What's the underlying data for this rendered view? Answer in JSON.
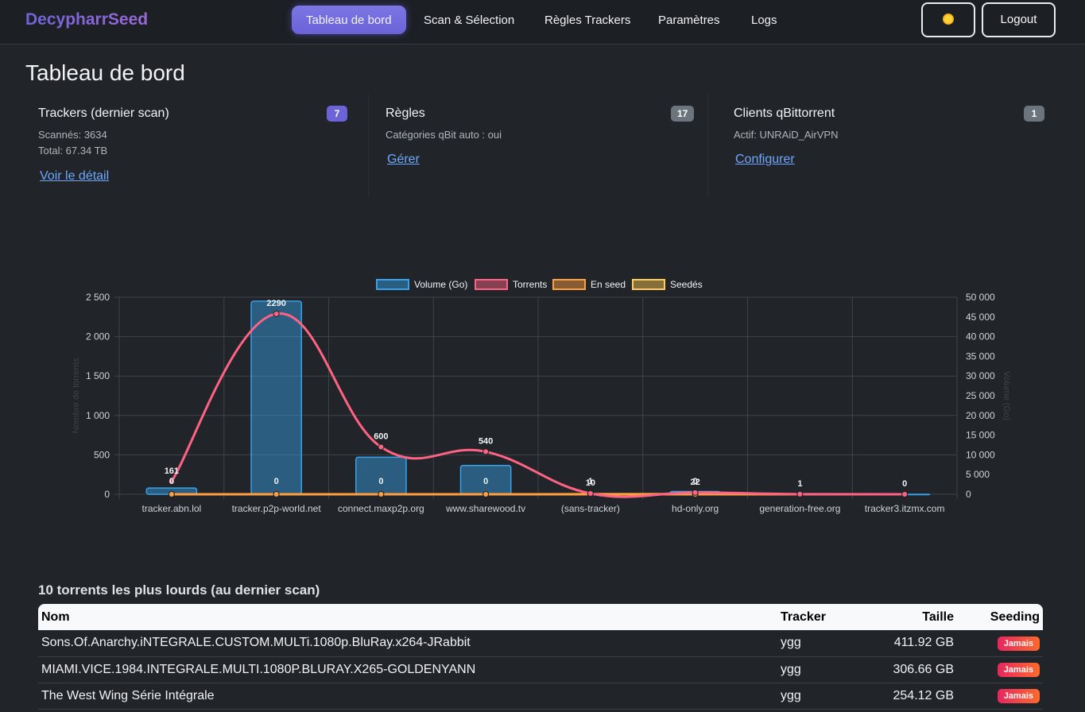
{
  "app": {
    "brand": "DecypharrSeed"
  },
  "nav": {
    "links": [
      "Tableau de bord",
      "Scan & Sélection",
      "Règles Trackers",
      "Paramètres",
      "Logs"
    ],
    "logout_label": "Logout"
  },
  "page": {
    "title": "Tableau de bord"
  },
  "cards": {
    "trackers": {
      "title": "Trackers (dernier scan)",
      "badge": "7",
      "line1": "Scannés: 3634",
      "line2": "Total: 67.34 TB",
      "link": "Voir le détail"
    },
    "rules": {
      "title": "Règles",
      "badge": "17",
      "line1": "Catégories qBit auto : oui",
      "link": "Gérer"
    },
    "clients": {
      "title": "Clients qBittorrent",
      "badge": "1",
      "line1": "Actif: UNRAiD_AirVPN",
      "link": "Configurer"
    }
  },
  "colors": {
    "accent": "#6c63d9",
    "badge_gray": "#6c757d",
    "link": "#6ea8fe",
    "danger_gradient_start": "#e8265e",
    "danger_gradient_end": "#fd6a2c"
  },
  "chart_data": {
    "type": "bar",
    "categories": [
      "tracker.abn.lol",
      "tracker.p2p-world.net",
      "connect.maxp2p.org",
      "www.sharewood.tv",
      "(sans-tracker)",
      "hd-only.org",
      "generation-free.org",
      "tracker3.itzmx.com"
    ],
    "series": [
      {
        "name": "Volume (Go)",
        "type": "bar",
        "axis": "right",
        "color": "#36a2eb",
        "values": [
          1600,
          49000,
          9400,
          7300,
          80,
          700,
          20,
          5
        ]
      },
      {
        "name": "Torrents",
        "type": "line",
        "axis": "left",
        "color": "#ff6384",
        "values": [
          161,
          2290,
          600,
          540,
          10,
          22,
          1,
          0
        ]
      },
      {
        "name": "En seed",
        "type": "line",
        "axis": "left",
        "color": "#ff9f40",
        "values": [
          0,
          0,
          0,
          0,
          0,
          0,
          0,
          0
        ]
      },
      {
        "name": "Seedés",
        "type": "line",
        "axis": "left",
        "color": "#ffcd56",
        "values": [
          0,
          0,
          0,
          0,
          1,
          2,
          0,
          0
        ]
      }
    ],
    "data_labels_top": [
      "161",
      "2290",
      "600",
      "540",
      "10",
      "22",
      "1",
      "0"
    ],
    "data_labels_bottom": [
      "0",
      "0",
      "0",
      "0",
      "1",
      "0",
      "",
      ""
    ],
    "y_left": {
      "label": "Nombre de torrents",
      "ticks": [
        "0",
        "500",
        "1 000",
        "1 500",
        "2 000",
        "2 500"
      ],
      "range": [
        0,
        2500
      ]
    },
    "y_right": {
      "label": "Volume (Go)",
      "ticks": [
        "0",
        "5 000",
        "10 000",
        "15 000",
        "20 000",
        "25 000",
        "30 000",
        "35 000",
        "40 000",
        "45 000",
        "50 000"
      ],
      "range": [
        0,
        50000
      ]
    },
    "legend_position": "top",
    "grid": true
  },
  "top_torrents": {
    "title": "10 torrents les plus lourds (au dernier scan)",
    "headers": [
      "Nom",
      "Tracker",
      "Taille",
      "Seeding"
    ],
    "rows": [
      [
        "Sons.Of.Anarchy.iNTEGRALE.CUSTOM.MULTi.1080p.BluRay.x264-JRabbit",
        "ygg",
        "411.92 GB",
        "Jamais"
      ],
      [
        "MIAMI.VICE.1984.INTEGRALE.MULTI.1080P.BLURAY.X265-GOLDENYANN",
        "ygg",
        "306.66 GB",
        "Jamais"
      ],
      [
        "The West Wing Série Intégrale",
        "ygg",
        "254.12 GB",
        "Jamais"
      ]
    ]
  }
}
